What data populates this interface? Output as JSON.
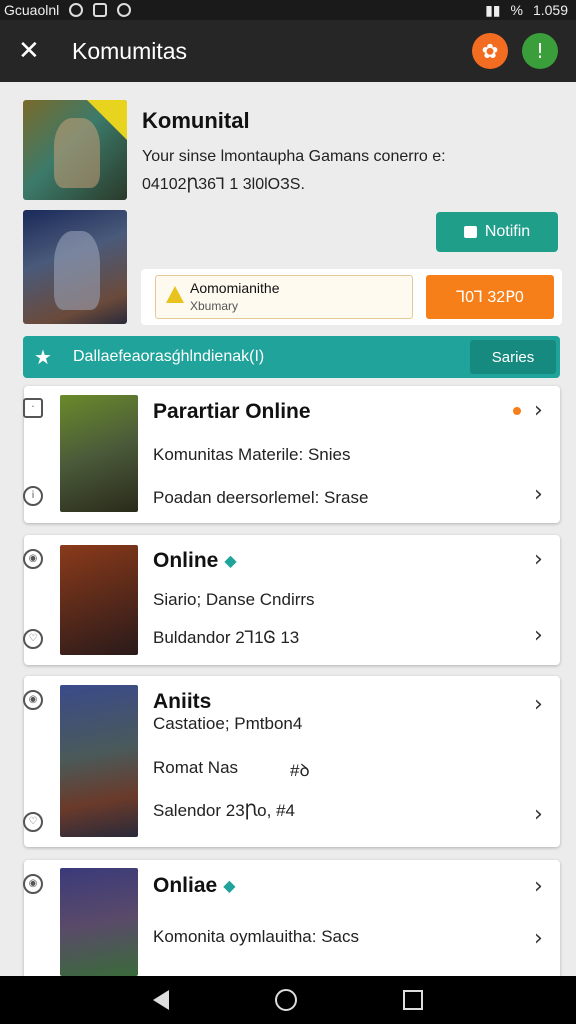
{
  "status": {
    "left_text": "Gcuaolnl",
    "right_text": "1.059",
    "signal": "%"
  },
  "app_bar": {
    "title": "Komumitas"
  },
  "community": {
    "title": "Komunital",
    "description": "Your sinse lmontaupha Gamans conerro e:",
    "id_line": "04102Ꞃ36Ꞁ 1 3l0lOЗS.",
    "notify_label": "Notifin",
    "info_line1": "Aomomianithe",
    "info_line2": "Xbumary",
    "orange_button": "Ꞁ0Ꞁ 32ꓑ0"
  },
  "banner": {
    "text": "Dallaefeaorasǵhlndienak(I)",
    "button": "Saries"
  },
  "cards": [
    {
      "title": "Parartiar Online",
      "line1": "Komunitas Materile: Snies",
      "line2": "Poadan deersorlemel: Srase",
      "badge": "",
      "dot": true
    },
    {
      "title": "Online",
      "line1": "Siario; Danse Cndirrs",
      "line2": "Buldandor 2Ꞁ1Ꮆ 13",
      "badge": "◆",
      "dot": false
    },
    {
      "title": "Aniits",
      "line1": "Castatioe; Pmtbon4",
      "line2": "Romat Nas",
      "line2b": "#ꝺ",
      "line3": "Salendor 23Ꞃo, #4",
      "badge": "",
      "dot": false
    },
    {
      "title": "Onliae",
      "line1": "Komonita oymlauitha: Sacs",
      "line2": "",
      "badge": "◆",
      "dot": false
    }
  ],
  "colors": {
    "teal": "#1fa39a",
    "orange": "#f77f1a",
    "appbar": "#262626"
  }
}
